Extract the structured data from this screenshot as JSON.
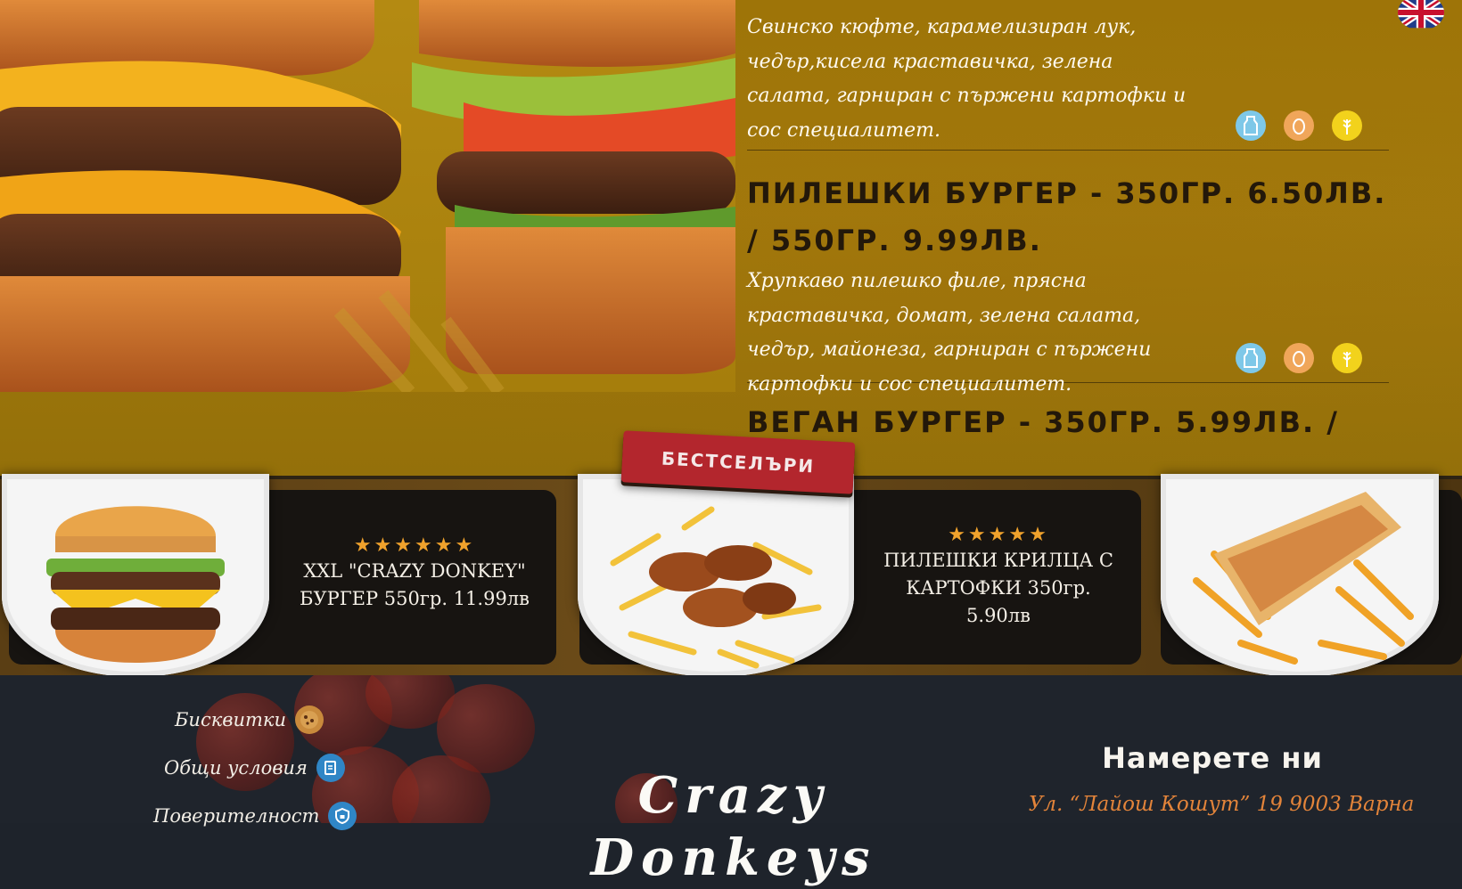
{
  "menu": {
    "items": [
      {
        "title": "",
        "description": "Свинско кюфте, карамелизиран лук, чедър,кисела краставичка, зелена салата, гарниран с пържени картофки и сос специалитет."
      },
      {
        "title": "ПИЛЕШКИ БУРГЕР - 350ГР. 6.50ЛВ. / 550ГР. 9.99ЛВ.",
        "description": "Хрупкаво пилешко филе, прясна краставичка, домат, зелена салата, чедър, майонеза, гарниран с пържени картофки и сос специалитет."
      },
      {
        "title": "ВЕГАН БУРГЕР - 350ГР. 5.99ЛВ. /",
        "description": ""
      }
    ],
    "allergen_icons": [
      "milk-icon",
      "egg-icon",
      "wheat-icon"
    ],
    "allergen_colors": [
      "#7ec8e8",
      "#f0a65a",
      "#f2d21c"
    ]
  },
  "bestsellers": {
    "ribbon_label": "БЕСТСЕЛЪРИ",
    "items": [
      {
        "stars": "★★★★★★",
        "name": "XXL \"CRAZY DONKEY\" БУРГЕР 550гр. 11.99лв"
      },
      {
        "stars": "★★★★★",
        "name": "ПИЛЕШКИ КРИЛЦА С КАРТОФКИ 350гр. 5.90лв"
      }
    ]
  },
  "footer": {
    "links": [
      {
        "label": "Бисквитки",
        "icon": "cookie-icon"
      },
      {
        "label": "Общи условия",
        "icon": "document-icon"
      },
      {
        "label": "Поверителност",
        "icon": "lock-shield-icon"
      }
    ],
    "brand": "Crazy Donkeys",
    "find_us_title": "Намерете ни",
    "address": "Ул. “Лайош Кошут” 19 9003 Варна"
  },
  "colors": {
    "menu_background": "#9e7408",
    "title_text": "#23180a",
    "ribbon": "#b3262d",
    "star": "#f0a22c",
    "footer_background": "#1f242c",
    "address": "#e3843a"
  }
}
